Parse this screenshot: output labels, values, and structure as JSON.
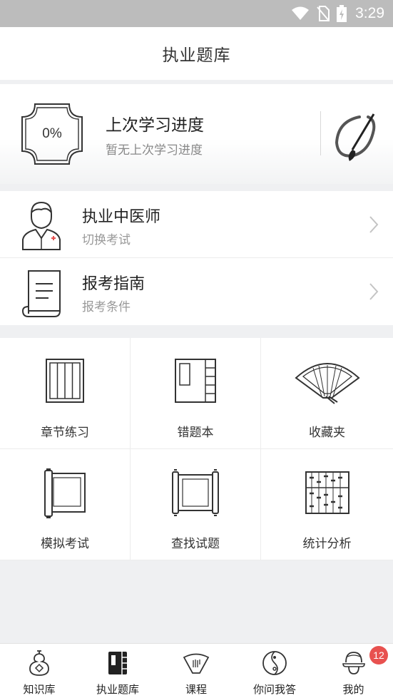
{
  "status_bar": {
    "time": "3:29",
    "icons": [
      "wifi-icon",
      "no-sim-icon",
      "battery-charging-icon"
    ]
  },
  "header": {
    "title": "执业题库"
  },
  "progress": {
    "value": "0%",
    "title": "上次学习进度",
    "subtitle": "暂无上次学习进度",
    "icons": [
      "progress-badge-icon",
      "brush-icon"
    ]
  },
  "exam_list": [
    {
      "title": "执业中医师",
      "subtitle": "切换考试",
      "icon": "doctor-icon"
    },
    {
      "title": "报考指南",
      "subtitle": "报考条件",
      "icon": "scroll-document-icon"
    }
  ],
  "grid": [
    {
      "label": "章节练习",
      "icon": "chapter-practice-icon"
    },
    {
      "label": "错题本",
      "icon": "wrong-book-icon"
    },
    {
      "label": "收藏夹",
      "icon": "fan-favorites-icon"
    },
    {
      "label": "模拟考试",
      "icon": "mock-exam-scroll-icon"
    },
    {
      "label": "查找试题",
      "icon": "search-questions-scroll-icon"
    },
    {
      "label": "统计分析",
      "icon": "abacus-statistics-icon"
    }
  ],
  "tabbar": {
    "items": [
      {
        "label": "知识库",
        "icon": "gourd-icon"
      },
      {
        "label": "执业题库",
        "icon": "book-icon",
        "active": true
      },
      {
        "label": "课程",
        "icon": "fan-icon"
      },
      {
        "label": "你问我答",
        "icon": "yin-yang-icon"
      },
      {
        "label": "我的",
        "icon": "profile-icon"
      }
    ],
    "badge": "12"
  },
  "colors": {
    "badge": "#e8514f",
    "status_bar": "#bcbcbc",
    "background": "#eff0f2"
  }
}
